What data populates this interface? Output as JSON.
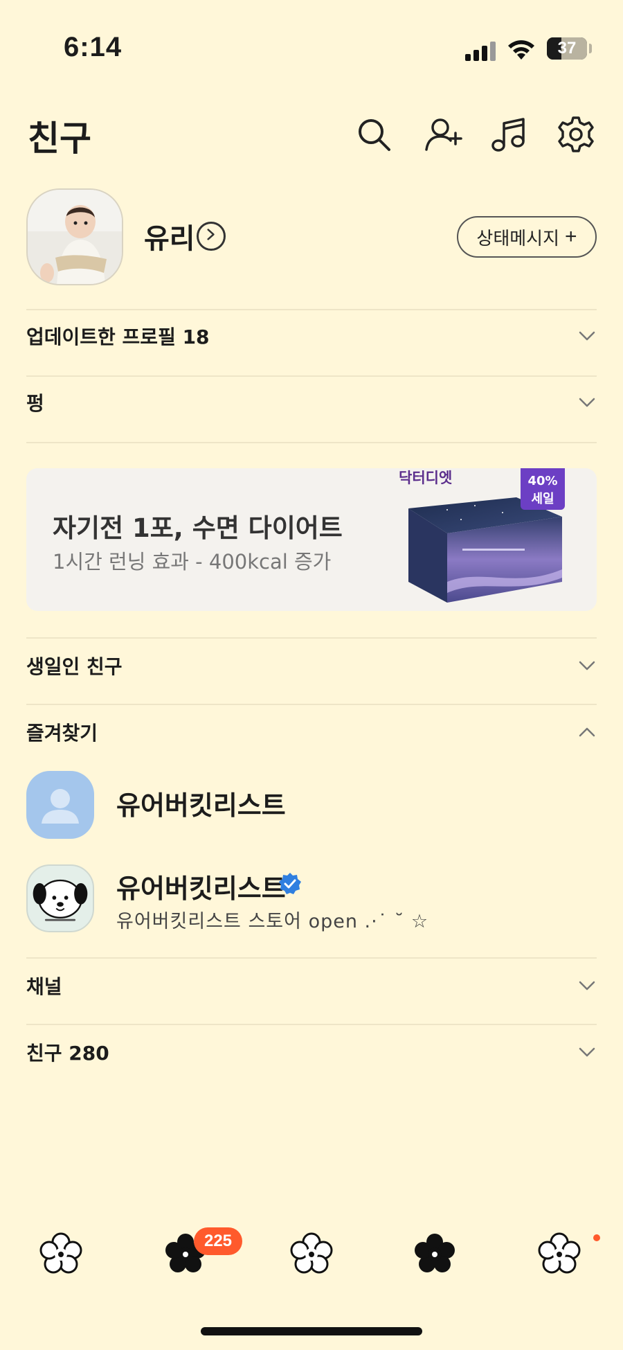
{
  "status_bar": {
    "time": "6:14",
    "battery": "37",
    "battery_level": 0.37
  },
  "header": {
    "title": "친구",
    "icons": [
      "search-icon",
      "add-friend-icon",
      "music-icon",
      "settings-icon"
    ]
  },
  "profile": {
    "name": "유리",
    "status_button": "상태메시지",
    "status_button_icon": "+"
  },
  "sections": {
    "updated_profiles": "업데이트한 프로필 18",
    "pung": "펑",
    "birthday": "생일인 친구",
    "favorites": "즐겨찾기",
    "channels": "채널",
    "friends": "친구 280"
  },
  "ad": {
    "title": "자기전 1포, 수면 다이어트",
    "subtitle": "1시간 런닝 효과 - 400kcal 증가",
    "brand": "닥터디엣",
    "sale_pct": "40%",
    "sale_word": "세일"
  },
  "favorites": [
    {
      "name": "유어버킷리스트",
      "status": ""
    },
    {
      "name": "유어버킷리스트",
      "status": "유어버킷리스트 스토어 open .·˙ ˘ ☆",
      "verified": true
    }
  ],
  "bottom_nav": {
    "badge": "225"
  },
  "colors": {
    "background": "#fff7d9",
    "badge": "#ff5a2c",
    "verified": "#2f7fe0",
    "sale": "#6c3fc4"
  }
}
